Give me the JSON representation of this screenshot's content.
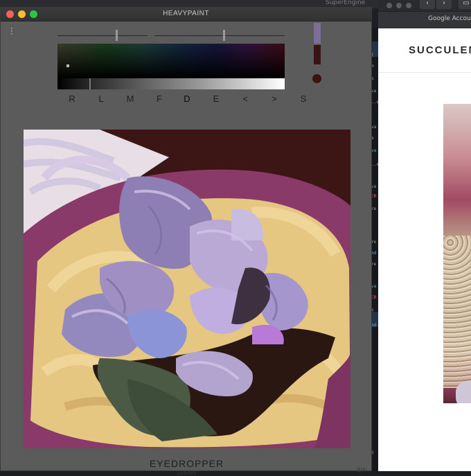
{
  "app": {
    "title": "HEAVYPAINT",
    "tool_name": "EYEDROPPER",
    "version": "1.4.5 OSX",
    "initials": "BW",
    "tool_keys": [
      "R",
      "L",
      "M",
      "F",
      "D",
      "E",
      "<",
      ">",
      "S"
    ],
    "active_tool_key": "D",
    "sliders": [
      {
        "name": "brush-size",
        "value": 0.65
      },
      {
        "name": "brush-opacity",
        "value": 0.53
      }
    ],
    "colors": {
      "primary": "#7b6f9a",
      "secondary": "#3a1413",
      "window_bg": "#5b5b5c"
    }
  },
  "background": {
    "editor_title": "SuperEngine",
    "browser_tab": "Google Account",
    "site_heading": "SUCCULENTS"
  }
}
